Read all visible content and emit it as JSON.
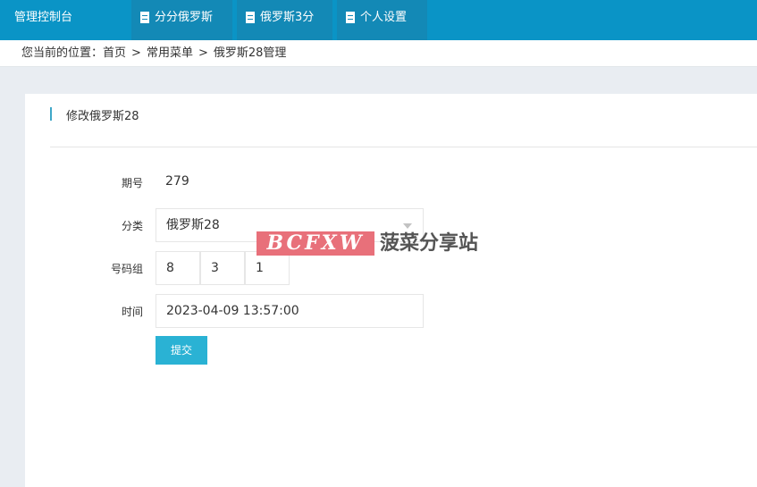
{
  "topbar": {
    "brand": "管理控制台",
    "nav": [
      {
        "label": "分分俄罗斯",
        "icon": "document-icon"
      },
      {
        "label": "俄罗斯3分",
        "icon": "document-icon"
      },
      {
        "label": "个人设置",
        "icon": "document-icon"
      }
    ]
  },
  "breadcrumb": {
    "prefix": "您当前的位置：",
    "items": [
      "首页",
      "常用菜单",
      "俄罗斯28管理"
    ],
    "separator": ">"
  },
  "panel": {
    "title": "修改俄罗斯28"
  },
  "form": {
    "period_label": "期号",
    "period_value": "279",
    "category_label": "分类",
    "category_value": "俄罗斯28",
    "numbers_label": "号码组",
    "numbers": [
      "8",
      "3",
      "1"
    ],
    "time_label": "时间",
    "time_value": "2023-04-09 13:57:00",
    "submit_label": "提交"
  },
  "watermark": {
    "logo": "BCFXW",
    "text": "菠菜分享站"
  },
  "colors": {
    "topbar": "#0a94c6",
    "nav_item": "#1389b6",
    "submit": "#2ab2d4",
    "title_bar": "#3fa7c8",
    "watermark_logo": "#e8707a"
  }
}
